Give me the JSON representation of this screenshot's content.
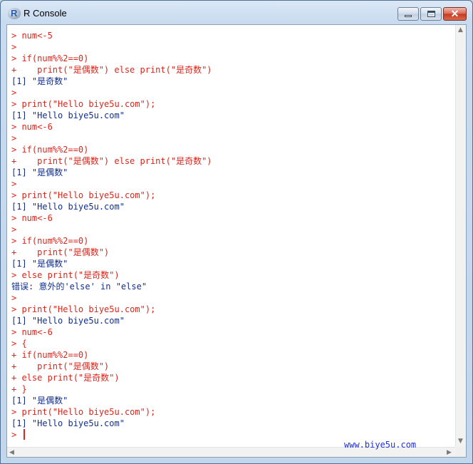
{
  "window": {
    "title": "R Console",
    "icon_letter": "R"
  },
  "controls": {
    "minimize": "minimize",
    "maximize": "maximize",
    "close": "✕"
  },
  "console": {
    "lines": [
      {
        "text": "> num<-5",
        "kind": "in"
      },
      {
        "text": ">",
        "kind": "in"
      },
      {
        "text": "> if(num%%2==0)",
        "kind": "in"
      },
      {
        "text": "+    print(\"是偶数\") else print(\"是奇数\")",
        "kind": "in"
      },
      {
        "text": "[1] \"是奇数\"",
        "kind": "out"
      },
      {
        "text": ">",
        "kind": "in"
      },
      {
        "text": "> print(\"Hello biye5u.com\");",
        "kind": "in"
      },
      {
        "text": "[1] \"Hello biye5u.com\"",
        "kind": "out"
      },
      {
        "text": "> num<-6",
        "kind": "in"
      },
      {
        "text": ">",
        "kind": "in"
      },
      {
        "text": "> if(num%%2==0)",
        "kind": "in"
      },
      {
        "text": "+    print(\"是偶数\") else print(\"是奇数\")",
        "kind": "in"
      },
      {
        "text": "[1] \"是偶数\"",
        "kind": "out"
      },
      {
        "text": ">",
        "kind": "in"
      },
      {
        "text": "> print(\"Hello biye5u.com\");",
        "kind": "in"
      },
      {
        "text": "[1] \"Hello biye5u.com\"",
        "kind": "out"
      },
      {
        "text": "> num<-6",
        "kind": "in"
      },
      {
        "text": ">",
        "kind": "in"
      },
      {
        "text": "> if(num%%2==0)",
        "kind": "in"
      },
      {
        "text": "+    print(\"是偶数\")",
        "kind": "in"
      },
      {
        "text": "[1] \"是偶数\"",
        "kind": "out"
      },
      {
        "text": "> else print(\"是奇数\")",
        "kind": "in"
      },
      {
        "text": "错误: 意外的'else' in \"else\"",
        "kind": "out"
      },
      {
        "text": ">",
        "kind": "in"
      },
      {
        "text": "> print(\"Hello biye5u.com\");",
        "kind": "in"
      },
      {
        "text": "[1] \"Hello biye5u.com\"",
        "kind": "out"
      },
      {
        "text": "> num<-6",
        "kind": "in"
      },
      {
        "text": "> {",
        "kind": "in"
      },
      {
        "text": "+ if(num%%2==0)",
        "kind": "in"
      },
      {
        "text": "+    print(\"是偶数\")",
        "kind": "in"
      },
      {
        "text": "+ else print(\"是奇数\")",
        "kind": "in"
      },
      {
        "text": "+ }",
        "kind": "in"
      },
      {
        "text": "[1] \"是偶数\"",
        "kind": "out"
      },
      {
        "text": "> print(\"Hello biye5u.com\");",
        "kind": "in"
      },
      {
        "text": "[1] \"Hello biye5u.com\"",
        "kind": "out"
      },
      {
        "text": ">",
        "kind": "in"
      }
    ]
  },
  "watermark": "www.biye5u.com",
  "scrollbars": {
    "up": "▲",
    "down": "▼",
    "left": "◀",
    "right": "▶"
  },
  "colors": {
    "input": "#d9261c",
    "output": "#132f8c"
  }
}
